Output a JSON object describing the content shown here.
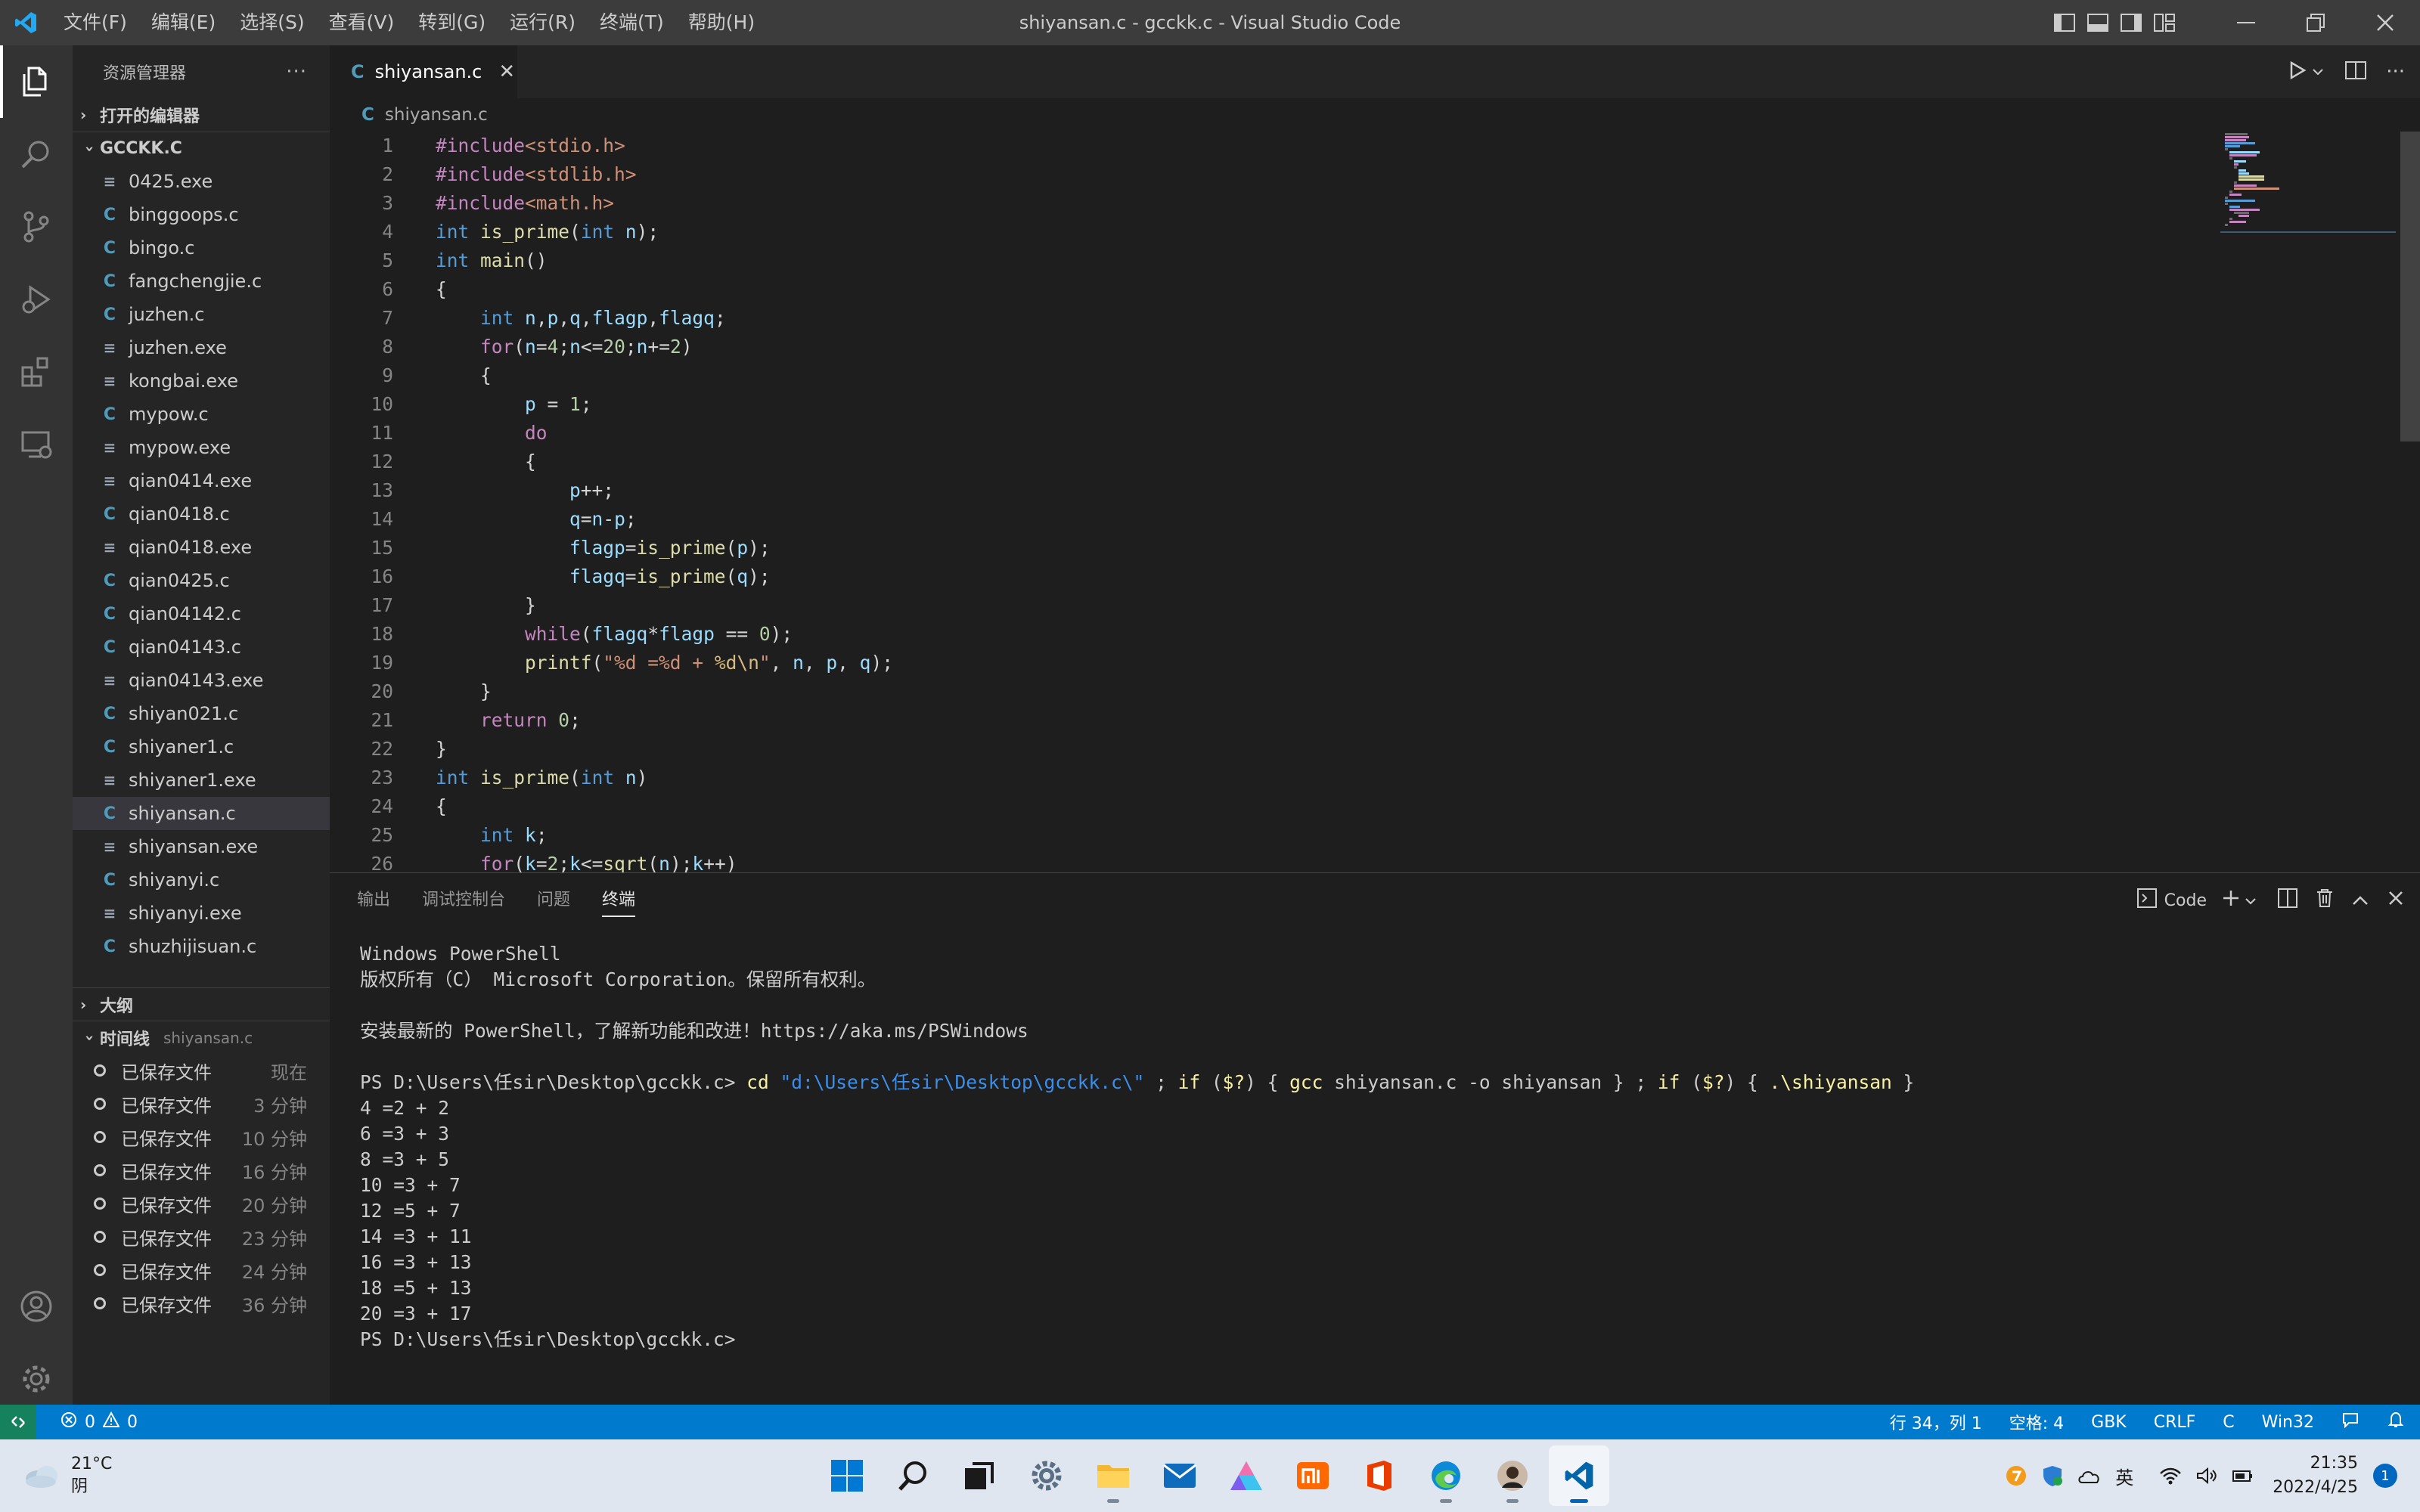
{
  "window": {
    "title": "shiyansan.c - gcckk.c - Visual Studio Code",
    "menu": [
      "文件(F)",
      "编辑(E)",
      "选择(S)",
      "查看(V)",
      "转到(G)",
      "运行(R)",
      "终端(T)",
      "帮助(H)"
    ]
  },
  "sidebar": {
    "header": "资源管理器",
    "open_editors": "打开的编辑器",
    "folder": "GCCKK.C",
    "files": [
      {
        "name": "0425.exe",
        "type": "exe"
      },
      {
        "name": "binggoops.c",
        "type": "c"
      },
      {
        "name": "bingo.c",
        "type": "c"
      },
      {
        "name": "fangchengjie.c",
        "type": "c"
      },
      {
        "name": "juzhen.c",
        "type": "c"
      },
      {
        "name": "juzhen.exe",
        "type": "exe"
      },
      {
        "name": "kongbai.exe",
        "type": "exe"
      },
      {
        "name": "mypow.c",
        "type": "c"
      },
      {
        "name": "mypow.exe",
        "type": "exe"
      },
      {
        "name": "qian0414.exe",
        "type": "exe"
      },
      {
        "name": "qian0418.c",
        "type": "c"
      },
      {
        "name": "qian0418.exe",
        "type": "exe"
      },
      {
        "name": "qian0425.c",
        "type": "c"
      },
      {
        "name": "qian04142.c",
        "type": "c"
      },
      {
        "name": "qian04143.c",
        "type": "c"
      },
      {
        "name": "qian04143.exe",
        "type": "exe"
      },
      {
        "name": "shiyan021.c",
        "type": "c"
      },
      {
        "name": "shiyaner1.c",
        "type": "c"
      },
      {
        "name": "shiyaner1.exe",
        "type": "exe"
      },
      {
        "name": "shiyansan.c",
        "type": "c",
        "selected": true
      },
      {
        "name": "shiyansan.exe",
        "type": "exe"
      },
      {
        "name": "shiyanyi.c",
        "type": "c"
      },
      {
        "name": "shiyanyi.exe",
        "type": "exe"
      },
      {
        "name": "shuzhijisuan.c",
        "type": "c"
      }
    ],
    "outline": "大纲",
    "timeline": "时间线",
    "timeline_file": "shiyansan.c",
    "timeline_items": [
      {
        "label": "已保存文件",
        "time": "现在"
      },
      {
        "label": "已保存文件",
        "time": "3 分钟"
      },
      {
        "label": "已保存文件",
        "time": "10 分钟"
      },
      {
        "label": "已保存文件",
        "time": "16 分钟"
      },
      {
        "label": "已保存文件",
        "time": "20 分钟"
      },
      {
        "label": "已保存文件",
        "time": "23 分钟"
      },
      {
        "label": "已保存文件",
        "time": "24 分钟"
      },
      {
        "label": "已保存文件",
        "time": "36 分钟"
      }
    ]
  },
  "editor": {
    "tab": "shiyansan.c",
    "breadcrumb": "shiyansan.c",
    "lines": [
      [
        [
          "pp",
          "#include"
        ],
        [
          "inc",
          "<stdio.h>"
        ]
      ],
      [
        [
          "pp",
          "#include"
        ],
        [
          "inc",
          "<stdlib.h>"
        ]
      ],
      [
        [
          "pp",
          "#include"
        ],
        [
          "inc",
          "<math.h>"
        ]
      ],
      [
        [
          "kw",
          "int"
        ],
        [
          "t",
          " "
        ],
        [
          "fn",
          "is_prime"
        ],
        [
          "t",
          "("
        ],
        [
          "kw",
          "int"
        ],
        [
          "t",
          " "
        ],
        [
          "vr",
          "n"
        ],
        [
          "t",
          ");"
        ]
      ],
      [
        [
          "kw",
          "int"
        ],
        [
          "t",
          " "
        ],
        [
          "fn",
          "main"
        ],
        [
          "t",
          "()"
        ]
      ],
      [
        [
          "t",
          "{"
        ]
      ],
      [
        [
          "t",
          "    "
        ],
        [
          "kw",
          "int"
        ],
        [
          "t",
          " "
        ],
        [
          "vr",
          "n"
        ],
        [
          "t",
          ","
        ],
        [
          "vr",
          "p"
        ],
        [
          "t",
          ","
        ],
        [
          "vr",
          "q"
        ],
        [
          "t",
          ","
        ],
        [
          "vr",
          "flagp"
        ],
        [
          "t",
          ","
        ],
        [
          "vr",
          "flagq"
        ],
        [
          "t",
          ";"
        ]
      ],
      [
        [
          "t",
          "    "
        ],
        [
          "ctl",
          "for"
        ],
        [
          "t",
          "("
        ],
        [
          "vr",
          "n"
        ],
        [
          "t",
          "="
        ],
        [
          "num",
          "4"
        ],
        [
          "t",
          ";"
        ],
        [
          "vr",
          "n"
        ],
        [
          "t",
          "<="
        ],
        [
          "num",
          "20"
        ],
        [
          "t",
          ";"
        ],
        [
          "vr",
          "n"
        ],
        [
          "t",
          "+="
        ],
        [
          "num",
          "2"
        ],
        [
          "t",
          ")"
        ]
      ],
      [
        [
          "t",
          "    {"
        ]
      ],
      [
        [
          "t",
          "        "
        ],
        [
          "vr",
          "p"
        ],
        [
          "t",
          " = "
        ],
        [
          "num",
          "1"
        ],
        [
          "t",
          ";"
        ]
      ],
      [
        [
          "t",
          "        "
        ],
        [
          "ctl",
          "do"
        ]
      ],
      [
        [
          "t",
          "        {"
        ]
      ],
      [
        [
          "t",
          "            "
        ],
        [
          "vr",
          "p"
        ],
        [
          "t",
          "++;"
        ]
      ],
      [
        [
          "t",
          "            "
        ],
        [
          "vr",
          "q"
        ],
        [
          "t",
          "="
        ],
        [
          "vr",
          "n"
        ],
        [
          "t",
          "-"
        ],
        [
          "vr",
          "p"
        ],
        [
          "t",
          ";"
        ]
      ],
      [
        [
          "t",
          "            "
        ],
        [
          "vr",
          "flagp"
        ],
        [
          "t",
          "="
        ],
        [
          "fn",
          "is_prime"
        ],
        [
          "t",
          "("
        ],
        [
          "vr",
          "p"
        ],
        [
          "t",
          ");"
        ]
      ],
      [
        [
          "t",
          "            "
        ],
        [
          "vr",
          "flagq"
        ],
        [
          "t",
          "="
        ],
        [
          "fn",
          "is_prime"
        ],
        [
          "t",
          "("
        ],
        [
          "vr",
          "q"
        ],
        [
          "t",
          ");"
        ]
      ],
      [
        [
          "t",
          "        }"
        ]
      ],
      [
        [
          "t",
          "        "
        ],
        [
          "ctl",
          "while"
        ],
        [
          "t",
          "("
        ],
        [
          "vr",
          "flagq"
        ],
        [
          "t",
          "*"
        ],
        [
          "vr",
          "flagp"
        ],
        [
          "t",
          " == "
        ],
        [
          "num",
          "0"
        ],
        [
          "t",
          ");"
        ]
      ],
      [
        [
          "t",
          "        "
        ],
        [
          "fn",
          "printf"
        ],
        [
          "t",
          "("
        ],
        [
          "str",
          "\"%d =%d + "
        ],
        [
          "esc",
          "%d\\n"
        ],
        [
          "str",
          "\""
        ],
        [
          "t",
          ", "
        ],
        [
          "vr",
          "n"
        ],
        [
          "t",
          ", "
        ],
        [
          "vr",
          "p"
        ],
        [
          "t",
          ", "
        ],
        [
          "vr",
          "q"
        ],
        [
          "t",
          ");"
        ]
      ],
      [
        [
          "t",
          "    }"
        ]
      ],
      [
        [
          "t",
          "    "
        ],
        [
          "ctl",
          "return"
        ],
        [
          "t",
          " "
        ],
        [
          "num",
          "0"
        ],
        [
          "t",
          ";"
        ]
      ],
      [
        [
          "t",
          "}"
        ]
      ],
      [
        [
          "kw",
          "int"
        ],
        [
          "t",
          " "
        ],
        [
          "fn",
          "is_prime"
        ],
        [
          "t",
          "("
        ],
        [
          "kw",
          "int"
        ],
        [
          "t",
          " "
        ],
        [
          "vr",
          "n"
        ],
        [
          "t",
          ")"
        ]
      ],
      [
        [
          "t",
          "{"
        ]
      ],
      [
        [
          "t",
          "    "
        ],
        [
          "kw",
          "int"
        ],
        [
          "t",
          " "
        ],
        [
          "vr",
          "k"
        ],
        [
          "t",
          ";"
        ]
      ],
      [
        [
          "t",
          "    "
        ],
        [
          "ctl",
          "for"
        ],
        [
          "t",
          "("
        ],
        [
          "vr",
          "k"
        ],
        [
          "t",
          "="
        ],
        [
          "num",
          "2"
        ],
        [
          "t",
          ";"
        ],
        [
          "vr",
          "k"
        ],
        [
          "t",
          "<="
        ],
        [
          "fn",
          "sqrt"
        ],
        [
          "t",
          "("
        ],
        [
          "vr",
          "n"
        ],
        [
          "t",
          ");"
        ],
        [
          "vr",
          "k"
        ],
        [
          "t",
          "++)"
        ]
      ]
    ]
  },
  "panel": {
    "tabs": [
      "输出",
      "调试控制台",
      "问题",
      "终端"
    ],
    "active_tab": "终端",
    "shell_label": "Code",
    "terminal": [
      [
        [
          "g",
          "Windows PowerShell"
        ]
      ],
      [
        [
          "g",
          "版权所有（C） Microsoft Corporation。保留所有权利。"
        ]
      ],
      [
        [
          "g",
          ""
        ]
      ],
      [
        [
          "g",
          "安装最新的 PowerShell，了解新功能和改进！https://aka.ms/PSWindows"
        ]
      ],
      [
        [
          "g",
          ""
        ]
      ],
      [
        [
          "g",
          "PS D:\\Users\\任sir\\Desktop\\gcckk.c> "
        ],
        [
          "y",
          "cd"
        ],
        [
          "g",
          " "
        ],
        [
          "b",
          "\"d:\\Users\\任sir\\Desktop\\gcckk.c\\\""
        ],
        [
          "g",
          " ; "
        ],
        [
          "y",
          "if"
        ],
        [
          "g",
          " ("
        ],
        [
          "y",
          "$?"
        ],
        [
          "g",
          ") { "
        ],
        [
          "y",
          "gcc"
        ],
        [
          "g",
          " shiyansan.c -o shiyansan } ; "
        ],
        [
          "y",
          "if"
        ],
        [
          "g",
          " ("
        ],
        [
          "y",
          "$?"
        ],
        [
          "g",
          ") { "
        ],
        [
          "y",
          ".\\shiyansan"
        ],
        [
          "g",
          " }"
        ]
      ],
      [
        [
          "g",
          "4 =2 + 2"
        ]
      ],
      [
        [
          "g",
          "6 =3 + 3"
        ]
      ],
      [
        [
          "g",
          "8 =3 + 5"
        ]
      ],
      [
        [
          "g",
          "10 =3 + 7"
        ]
      ],
      [
        [
          "g",
          "12 =5 + 7"
        ]
      ],
      [
        [
          "g",
          "14 =3 + 11"
        ]
      ],
      [
        [
          "g",
          "16 =3 + 13"
        ]
      ],
      [
        [
          "g",
          "18 =5 + 13"
        ]
      ],
      [
        [
          "g",
          "20 =3 + 17"
        ]
      ],
      [
        [
          "g",
          "PS D:\\Users\\任sir\\Desktop\\gcckk.c>"
        ]
      ]
    ]
  },
  "statusbar": {
    "errors": "0",
    "warnings": "0",
    "position": "行 34，列 1",
    "spaces": "空格: 4",
    "encoding": "GBK",
    "eol": "CRLF",
    "language": "C",
    "platform": "Win32"
  },
  "taskbar": {
    "temp": "21°C",
    "weather": "阴",
    "ime": "英",
    "time": "21:35",
    "date": "2022/4/25",
    "notifications": "1"
  },
  "colors": {
    "accent": "#007acc",
    "remote": "#16825d",
    "activitybar": "#333333",
    "sidebar": "#252526",
    "editor": "#1e1e1e"
  }
}
